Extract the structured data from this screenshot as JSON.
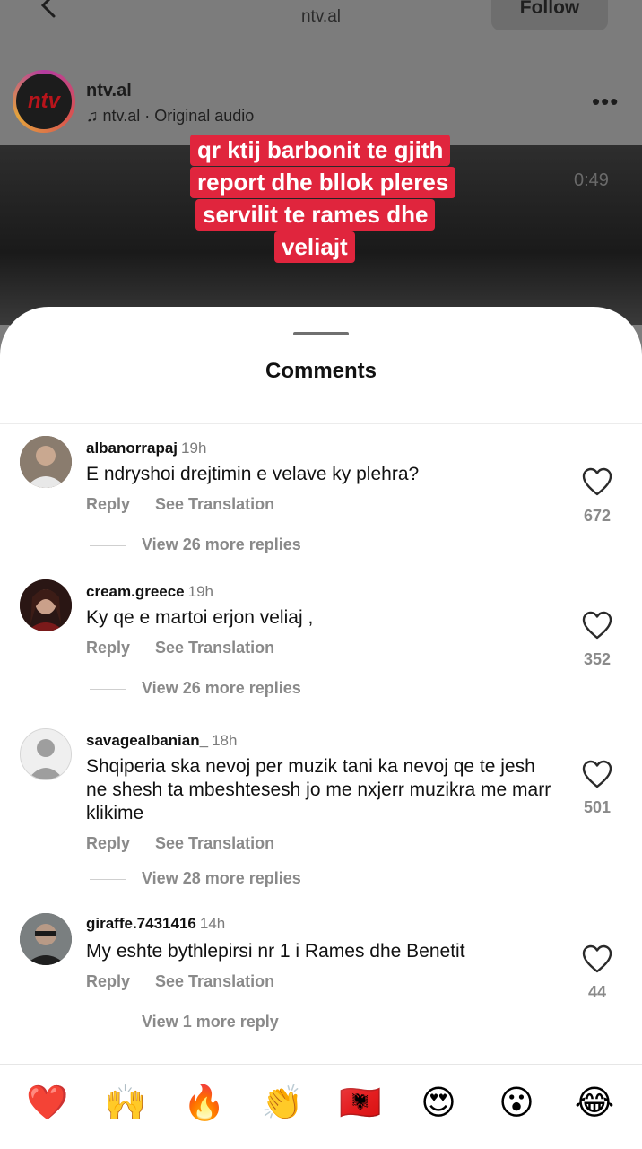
{
  "header": {
    "back_icon": "chevron-left-icon",
    "title": "ntv.al",
    "follow_label": "Follow"
  },
  "account": {
    "avatar_text": "ntv",
    "name": "ntv.al",
    "audio": "ntv.al · Original audio",
    "more_icon": "more-horizontal-icon"
  },
  "video": {
    "time": "0:49",
    "caption_lines": [
      "qr ktij barbonit te gjith",
      "report dhe bllok pleres",
      "servilit te rames dhe",
      "veliajt"
    ]
  },
  "sheet": {
    "title": "Comments"
  },
  "comments": [
    {
      "user": "albanorrapaj",
      "time": "19h",
      "text": "E ndryshoi drejtimin e velave ky plehra?",
      "reply": "Reply",
      "translate": "See Translation",
      "replies": "View 26 more replies",
      "likes": "672"
    },
    {
      "user": "cream.greece",
      "time": "19h",
      "text": "Ky qe e martoi erjon veliaj ,",
      "reply": "Reply",
      "translate": "See Translation",
      "replies": "View 26 more replies",
      "likes": "352"
    },
    {
      "user": "savagealbanian_",
      "time": "18h",
      "text": "Shqiperia ska nevoj per muzik tani ka nevoj qe te jesh ne shesh ta mbeshtesesh jo me nxjerr muzikra me marr klikime",
      "reply": "Reply",
      "translate": "See Translation",
      "replies": "View 28 more replies",
      "likes": "501"
    },
    {
      "user": "giraffe.7431416",
      "time": "14h",
      "text": "My eshte bythlepirsi nr 1 i Rames dhe Benetit",
      "reply": "Reply",
      "translate": "See Translation",
      "replies": "View 1 more reply",
      "likes": "44"
    }
  ],
  "emoji_bar": [
    "❤️",
    "🙌",
    "🔥",
    "👏",
    "🇦🇱",
    "😍",
    "😮",
    "😂"
  ],
  "colors": {
    "caption_bg": "#e0253d",
    "muted_text": "#8a8a8a"
  }
}
